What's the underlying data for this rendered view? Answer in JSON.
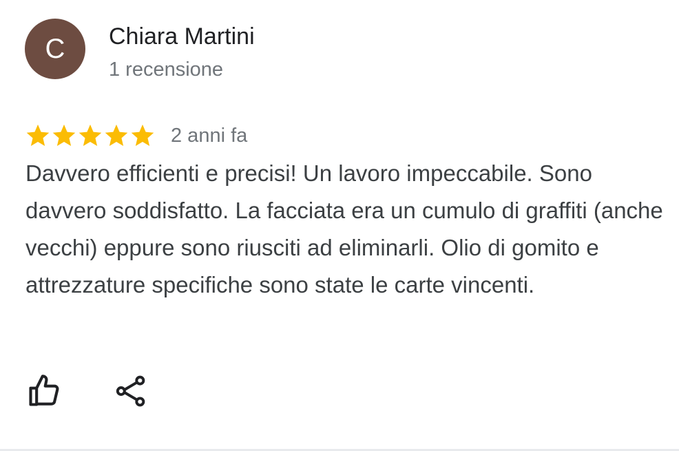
{
  "author": {
    "initial": "C",
    "name": "Chiara Martini",
    "meta": "1 recensione",
    "avatar_color": "#6d4c41"
  },
  "review": {
    "rating": 5,
    "max_rating": 5,
    "star_color": "#fbbc04",
    "date": "2 anni fa",
    "text": "Davvero efficienti e precisi! Un lavoro impeccabile. Sono davvero soddisfatto. La facciata era un cumulo di graffiti (anche vecchi) eppure sono riusciti ad eliminarli. Olio di gomito e attrezzature specifiche sono state le carte vincenti."
  },
  "actions": {
    "like_icon": "thumb-up-outline-icon",
    "share_icon": "share-icon"
  }
}
